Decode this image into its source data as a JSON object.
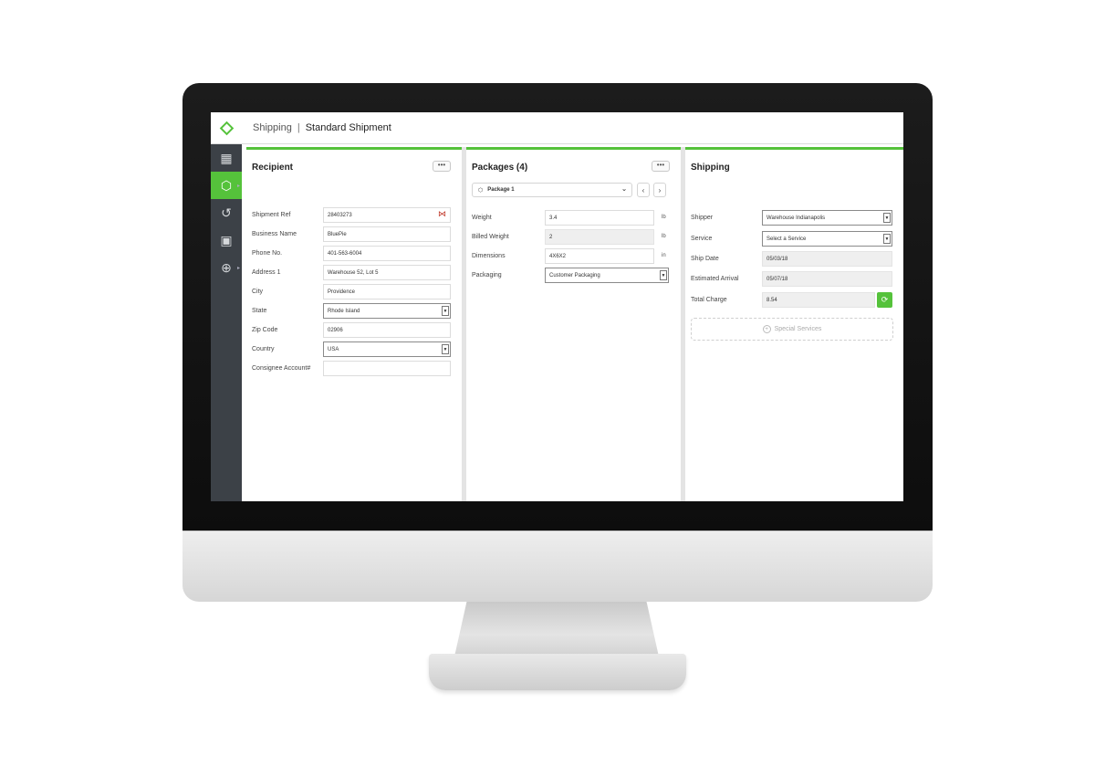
{
  "header": {
    "section": "Shipping",
    "separator": "|",
    "page_title": "Standard Shipment"
  },
  "sidebar": {
    "items": [
      {
        "name": "dashboard",
        "icon": "grid-icon",
        "glyph": "▦"
      },
      {
        "name": "shipping",
        "icon": "package-icon",
        "glyph": "⬡",
        "active": true
      },
      {
        "name": "history",
        "icon": "history-icon",
        "glyph": "↺"
      },
      {
        "name": "addressbook",
        "icon": "address-book-icon",
        "glyph": "▣"
      },
      {
        "name": "global",
        "icon": "globe-icon",
        "glyph": "⊕"
      }
    ]
  },
  "recipient": {
    "title": "Recipient",
    "more": "•••",
    "fields": [
      {
        "label": "Shipment Ref",
        "value": "28403273"
      },
      {
        "label": "Business Name",
        "value": "BluePie"
      },
      {
        "label": "Phone No.",
        "value": "401-563-6004"
      },
      {
        "label": "Address 1",
        "value": "Warehouse 52, Lot 5"
      },
      {
        "label": "City",
        "value": "Providence"
      },
      {
        "label": "State",
        "value": "Rhode Island"
      },
      {
        "label": "Zip Code",
        "value": "02906"
      },
      {
        "label": "Country",
        "value": "USA"
      },
      {
        "label": "Consignee Account#",
        "value": ""
      }
    ]
  },
  "packages": {
    "title": "Packages (4)",
    "more": "•••",
    "selected_package": "Package 1",
    "prev": "‹",
    "next": "›",
    "fields": [
      {
        "label": "Weight",
        "value": "3.4",
        "unit": "lb"
      },
      {
        "label": "Billed Weight",
        "value": "2",
        "unit": "lb"
      },
      {
        "label": "Dimensions",
        "value": "4X6X2",
        "unit": "in"
      },
      {
        "label": "Packaging",
        "value": "Customer Packaging"
      }
    ]
  },
  "shipping": {
    "title": "Shipping",
    "fields": [
      {
        "label": "Shipper",
        "value": "Warehouse Indianapolis"
      },
      {
        "label": "Service",
        "value": "Select a Service"
      },
      {
        "label": "Ship Date",
        "value": "05/03/18"
      },
      {
        "label": "Estimated Arrival",
        "value": "05/07/18"
      },
      {
        "label": "Total Charge",
        "value": "8.54"
      }
    ],
    "special_services": "Special Services",
    "refresh_icon": "⟳",
    "plus_icon": "+"
  },
  "colors": {
    "accent": "#55c23b",
    "sidebar": "#3c4147"
  }
}
